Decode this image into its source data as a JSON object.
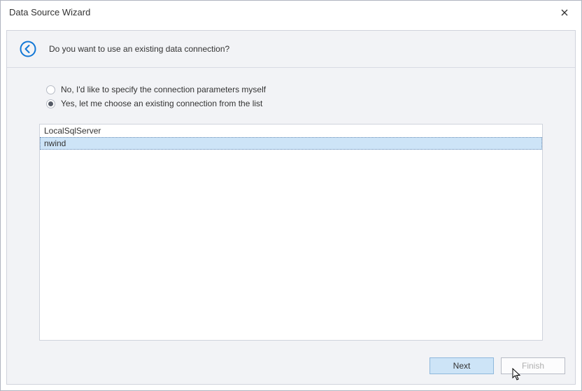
{
  "window": {
    "title": "Data Source Wizard"
  },
  "header": {
    "question": "Do you want to use an existing data connection?"
  },
  "options": {
    "opt1": {
      "label": "No, I'd like to specify the connection parameters myself",
      "selected": false
    },
    "opt2": {
      "label": "Yes, let me choose an existing connection from the list",
      "selected": true
    }
  },
  "connections": [
    {
      "name": "LocalSqlServer",
      "selected": false
    },
    {
      "name": "nwind",
      "selected": true
    }
  ],
  "buttons": {
    "next": "Next",
    "finish": "Finish"
  }
}
